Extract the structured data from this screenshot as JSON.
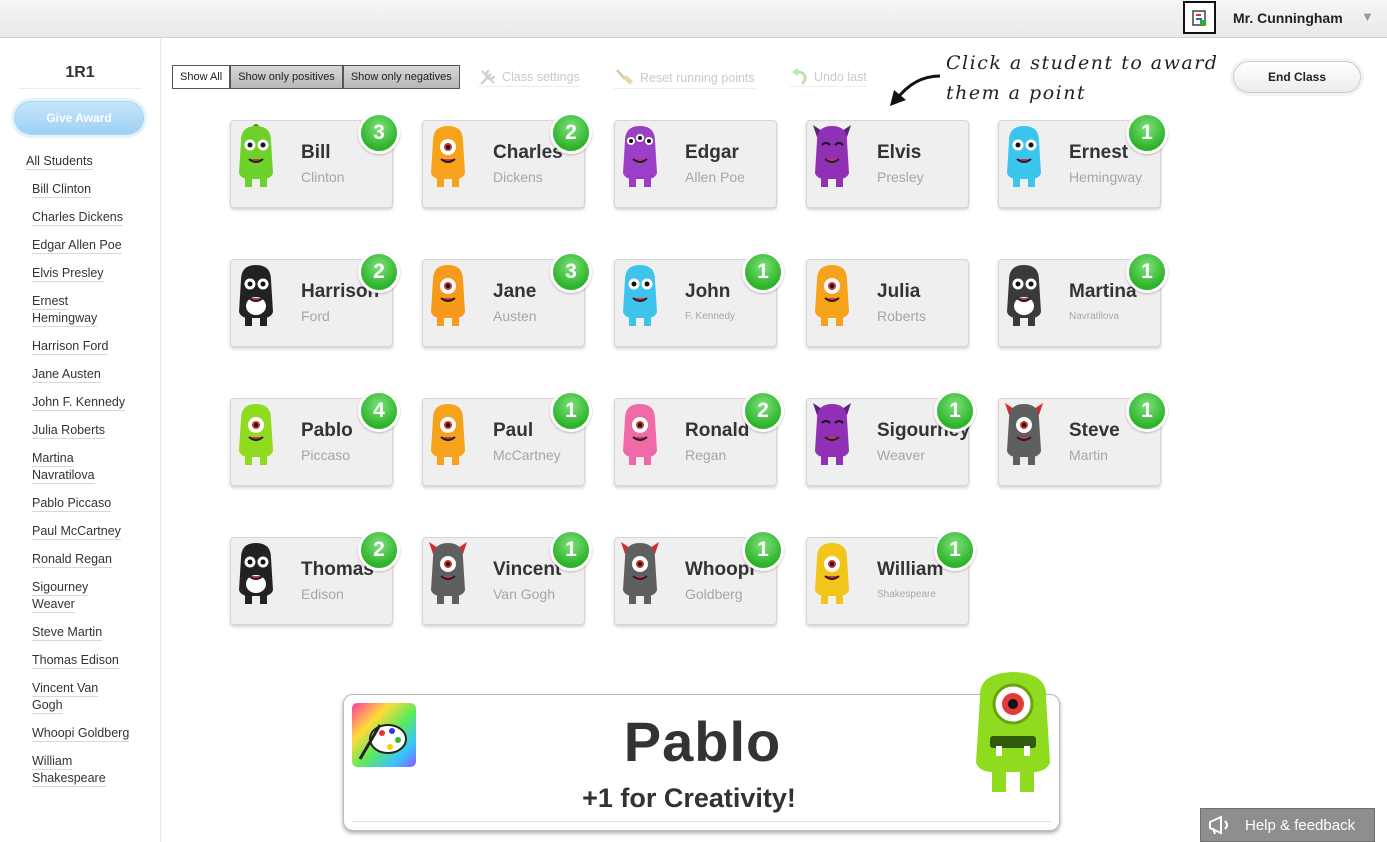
{
  "header": {
    "user_name": "Mr. Cunningham"
  },
  "sidebar": {
    "class_name": "1R1",
    "give_award": "Give Award",
    "all_students": "All Students",
    "students": [
      [
        "Bill Clinton"
      ],
      [
        "Charles Dickens"
      ],
      [
        "Edgar Allen Poe"
      ],
      [
        "Elvis Presley"
      ],
      [
        "Ernest",
        "Hemingway"
      ],
      [
        "Harrison Ford"
      ],
      [
        "Jane Austen"
      ],
      [
        "John F. Kennedy"
      ],
      [
        "Julia Roberts"
      ],
      [
        "Martina",
        "Navratilova"
      ],
      [
        "Pablo Piccaso"
      ],
      [
        "Paul McCartney"
      ],
      [
        "Ronald Regan"
      ],
      [
        "Sigourney",
        "Weaver"
      ],
      [
        "Steve Martin"
      ],
      [
        "Thomas Edison"
      ],
      [
        "Vincent Van",
        "Gogh"
      ],
      [
        "Whoopi Goldberg"
      ],
      [
        "William",
        "Shakespeare"
      ]
    ]
  },
  "toolbar": {
    "show_all": "Show All",
    "show_positives": "Show only positives",
    "show_negatives": "Show only negatives",
    "class_settings": "Class settings",
    "reset_points": "Reset running points",
    "undo_last": "Undo last",
    "hint_line1": "Click a student to award",
    "hint_line2": "them a point",
    "end_class": "End Class"
  },
  "students": [
    {
      "first": "Bill",
      "last": "Clinton",
      "points": "3",
      "monster": "green-antenna-monster"
    },
    {
      "first": "Charles",
      "last": "Dickens",
      "points": "2",
      "monster": "orange-cyclops-monster"
    },
    {
      "first": "Edgar",
      "last": "Allen Poe",
      "points": "",
      "monster": "purple-three-eyed-monster"
    },
    {
      "first": "Elvis",
      "last": "Presley",
      "points": "",
      "monster": "purple-horned-monster"
    },
    {
      "first": "Ernest",
      "last": "Hemingway",
      "points": "1",
      "monster": "cyan-two-eyed-monster"
    },
    {
      "first": "Harrison",
      "last": "Ford",
      "points": "2",
      "monster": "black-white-monster"
    },
    {
      "first": "Jane",
      "last": "Austen",
      "points": "3",
      "monster": "orange-round-monster"
    },
    {
      "first": "John",
      "last": "F. Kennedy",
      "points": "1",
      "monster": "cyan-bear-monster",
      "small": true
    },
    {
      "first": "Julia",
      "last": "Roberts",
      "points": "",
      "monster": "orange-cyclops-monster"
    },
    {
      "first": "Martina",
      "last": "Navratilova",
      "points": "1",
      "monster": "grey-panda-monster",
      "small": true
    },
    {
      "first": "Pablo",
      "last": "Piccaso",
      "points": "4",
      "monster": "green-cyclops-monster"
    },
    {
      "first": "Paul",
      "last": "McCartney",
      "points": "1",
      "monster": "orange-cyclops-monster"
    },
    {
      "first": "Ronald",
      "last": "Regan",
      "points": "2",
      "monster": "pink-monster"
    },
    {
      "first": "Sigourney",
      "last": "Weaver",
      "points": "1",
      "monster": "purple-horned-monster"
    },
    {
      "first": "Steve",
      "last": "Martin",
      "points": "1",
      "monster": "grey-devil-monster"
    },
    {
      "first": "Thomas",
      "last": "Edison",
      "points": "2",
      "monster": "black-white-monster"
    },
    {
      "first": "Vincent",
      "last": "Van Gogh",
      "points": "1",
      "monster": "grey-devil-monster"
    },
    {
      "first": "Whoopi",
      "last": "Goldberg",
      "points": "1",
      "monster": "grey-devil-monster"
    },
    {
      "first": "William",
      "last": "Shakespeare",
      "points": "1",
      "monster": "yellow-crazy-monster",
      "small": true
    }
  ],
  "award_popup": {
    "student": "Pablo",
    "message": "+1 for Creativity!",
    "skill_icon": "palette-icon",
    "monster": "green-cyclops-monster"
  },
  "help": {
    "label": "Help & feedback"
  },
  "colors": {
    "badge_green": "#2db32a",
    "give_award_blue": "#9dd1f4",
    "card_bg": "#efefef"
  }
}
